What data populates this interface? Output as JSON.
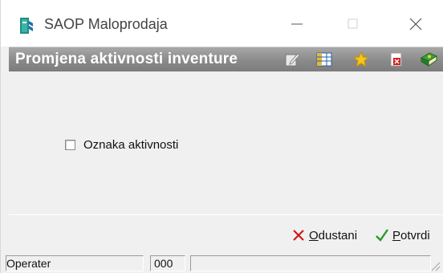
{
  "window": {
    "title": "SAOP Maloprodaja",
    "icons": {
      "app": "saop-app-icon",
      "minimize": "minimize-icon",
      "maximize": "maximize-icon",
      "close": "close-icon"
    }
  },
  "header": {
    "title": "Promjena aktivnosti inventure",
    "toolbar_icons": [
      "edit-icon",
      "grid-columns-icon",
      "favorite-star-icon",
      "delete-document-icon",
      "help-book-icon"
    ]
  },
  "form": {
    "checkbox_label": "Oznaka aktivnosti",
    "checked": false
  },
  "buttons": {
    "cancel": {
      "mnemonic": "O",
      "rest": "dustani"
    },
    "confirm": {
      "mnemonic": "P",
      "rest": "otvrdi"
    }
  },
  "statusbar": {
    "operator": "Operater",
    "code": "000",
    "extra": ""
  },
  "colors": {
    "header_bg": "#8a8a8a",
    "header_text": "#ffffff",
    "window_bg": "#f0f0f0",
    "cancel_x": "#d01818",
    "confirm_check": "#2a9a2a"
  }
}
